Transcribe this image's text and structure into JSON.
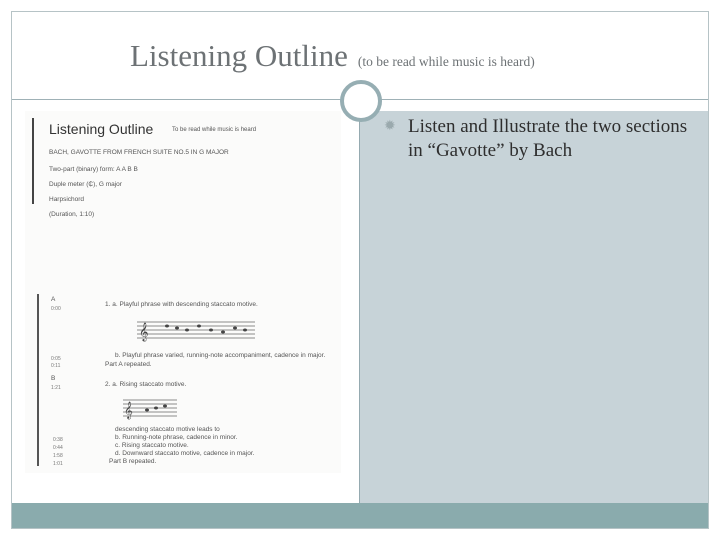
{
  "slide": {
    "title_main": "Listening Outline",
    "title_sub": "(to be read while music is heard)",
    "bullet_text": "Listen and Illustrate the two sections in “Gavotte” by Bach"
  },
  "document": {
    "title": "Listening Outline",
    "note": "To be read while music is heard",
    "piece": "BACH, GAVOTTE FROM FRENCH SUITE NO.5 IN G MAJOR",
    "form": "Two-part (binary) form: A A B B",
    "meter": "Duple meter (₵), G major",
    "instrument": "Harpsichord",
    "duration": "(Duration, 1:10)",
    "section_a_letter": "A",
    "section_a_time": "0:00",
    "item_1a": "1. a. Playful phrase with descending staccato motive.",
    "item_1b": "b. Playful phrase varied, running-note accompaniment, cadence in major.",
    "time_1b": "0:05",
    "time_1b2": "0:11",
    "part_a_repeated": "Part A repeated.",
    "section_b_letter": "B",
    "section_b_time": "1:21",
    "item_2a": "2. a. Rising staccato motive.",
    "item_2b_head": "descending staccato motive leads to",
    "item_2b": "b. Running-note phrase, cadence in minor.",
    "item_2c": "c. Rising staccato motive.",
    "item_2d": "d. Downward staccato motive, cadence in major.",
    "part_b_repeated": "Part B repeated.",
    "time_b1": "0:38",
    "time_b2": "0:44",
    "time_b3": "1:58",
    "time_b4": "1:01"
  },
  "colors": {
    "title": "#6d7275",
    "panel": "#c7d3d8",
    "footer": "#8aabad",
    "ring": "#96aeb3"
  }
}
